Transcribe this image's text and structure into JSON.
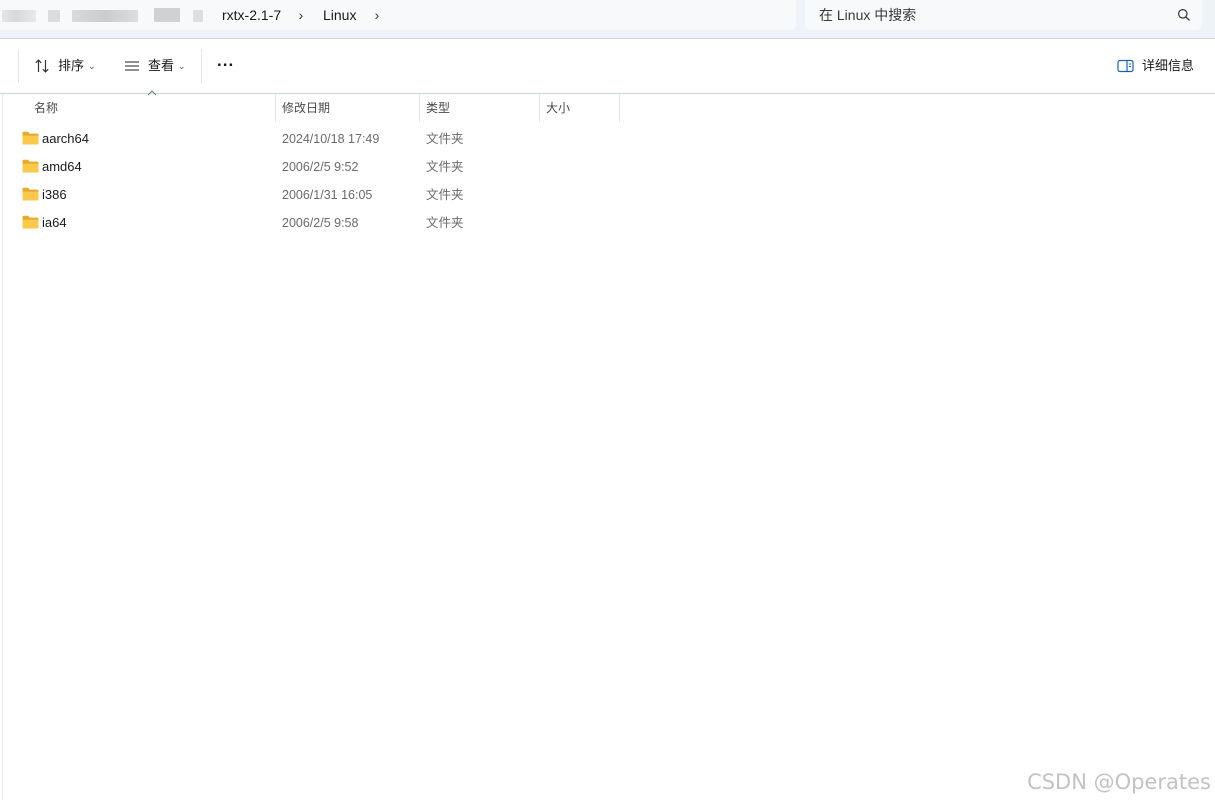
{
  "breadcrumb": {
    "items": [
      "rxtx-2.1-7",
      "Linux"
    ]
  },
  "search": {
    "placeholder": "在 Linux 中搜索"
  },
  "toolbar": {
    "sort_label": "排序",
    "view_label": "查看",
    "more_label": "...",
    "details_label": "详细信息"
  },
  "columns": {
    "name": "名称",
    "date": "修改日期",
    "type": "类型",
    "size": "大小"
  },
  "files": [
    {
      "name": "aarch64",
      "date": "2024/10/18 17:49",
      "type": "文件夹",
      "size": ""
    },
    {
      "name": "amd64",
      "date": "2006/2/5 9:52",
      "type": "文件夹",
      "size": ""
    },
    {
      "name": "i386",
      "date": "2006/1/31 16:05",
      "type": "文件夹",
      "size": ""
    },
    {
      "name": "ia64",
      "date": "2006/2/5 9:58",
      "type": "文件夹",
      "size": ""
    }
  ],
  "icons": {
    "folder": "folder-icon",
    "sort": "sort-icon",
    "view": "view-list-icon",
    "details": "details-pane-icon",
    "search": "search-icon"
  },
  "colors": {
    "folder": "#f5c542",
    "topbar_bg": "#eef3f8",
    "watermark": "#8a8a8a"
  },
  "watermark": "CSDN @Operates"
}
